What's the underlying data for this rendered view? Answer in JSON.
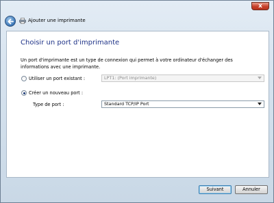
{
  "window": {
    "title": "Ajouter une imprimante",
    "close_label": "x"
  },
  "page": {
    "heading": "Choisir un port d'imprimante",
    "description": "Un port d'imprimante est un type de connexion qui permet à votre ordinateur d'échanger des informations avec une imprimante."
  },
  "existing_port": {
    "label": "Utiliser un port existant :",
    "value": "LPT1: (Port imprimante)",
    "selected": false
  },
  "new_port": {
    "label": "Créer un nouveau port :",
    "selected": true
  },
  "port_type": {
    "label": "Type de port :",
    "value": "Standard TCP/IP Port"
  },
  "buttons": {
    "next": "Suivant",
    "cancel": "Annuler"
  }
}
